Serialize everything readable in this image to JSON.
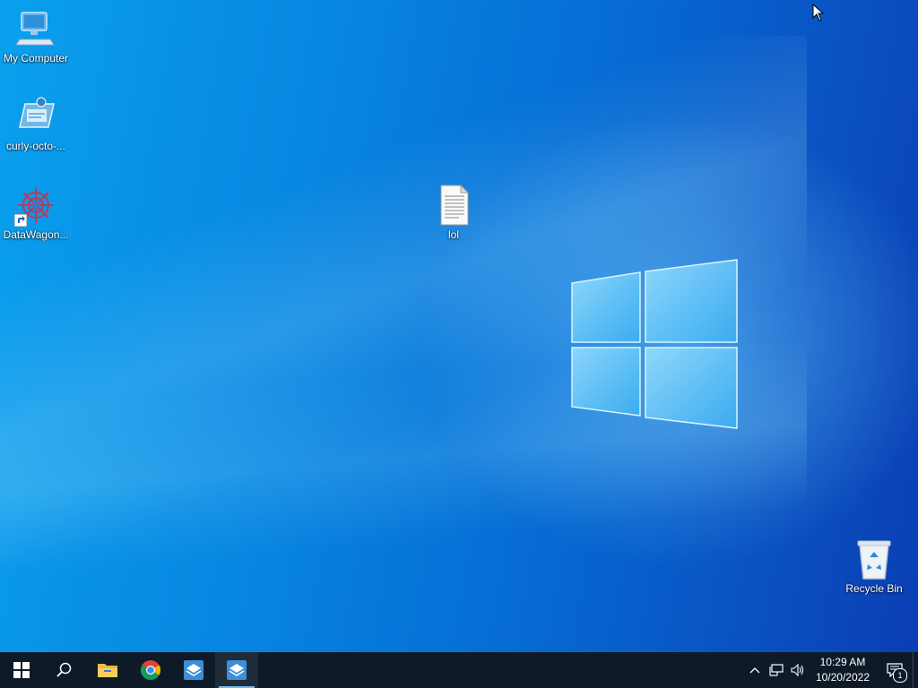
{
  "desktop": {
    "icons": [
      {
        "label": "My Computer",
        "icon": "computer-icon"
      },
      {
        "label": "curly-octo-...",
        "icon": "network-shortcut-icon"
      },
      {
        "label": "DataWagon...",
        "icon": "datawagon-icon"
      },
      {
        "label": "lol",
        "icon": "text-document-icon"
      },
      {
        "label": "Recycle Bin",
        "icon": "recycle-bin-icon"
      }
    ]
  },
  "taskbar": {
    "buttons": [
      {
        "icon": "start-icon"
      },
      {
        "icon": "search-icon"
      },
      {
        "icon": "file-explorer-icon"
      },
      {
        "icon": "chrome-icon"
      },
      {
        "icon": "app-icon"
      },
      {
        "icon": "app-icon-active"
      }
    ],
    "tray": {
      "clock_time": "10:29 AM",
      "clock_date": "10/20/2022",
      "notification_count": "1"
    }
  },
  "colors": {
    "taskbar": "#0e1a28",
    "desktop_accent": "#0784e0",
    "active_indicator": "#76b9ed"
  }
}
